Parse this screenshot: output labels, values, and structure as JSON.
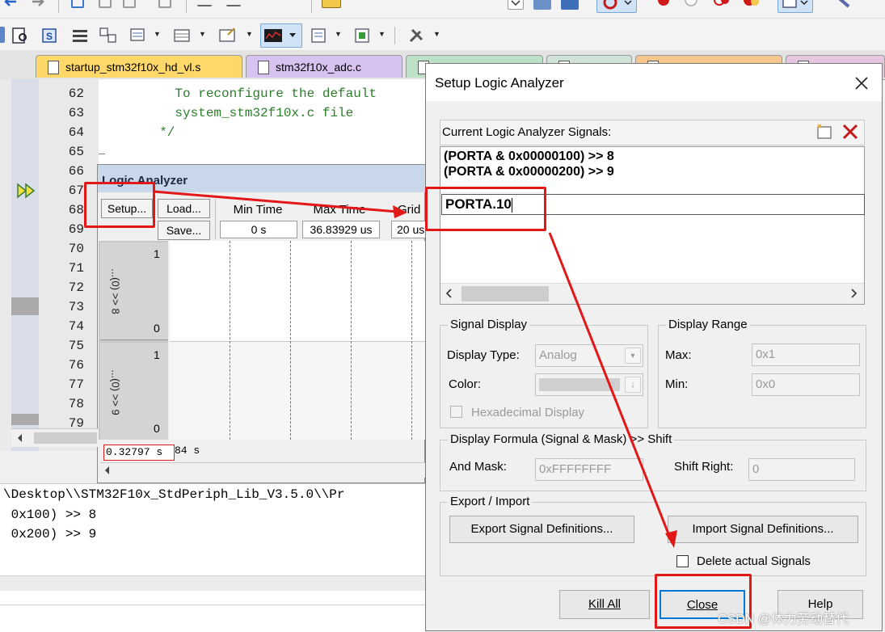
{
  "editor": {
    "tabs": [
      {
        "label": "startup_stm32f10x_hd_vl.s",
        "color": "#ffd86a"
      },
      {
        "label": "stm32f10x_adc.c",
        "color": "#d8c2f0"
      },
      {
        "label": "",
        "color": "#bde1c6"
      },
      {
        "label": "",
        "color": "#cfe3d6"
      },
      {
        "label": "",
        "color": "#f6c68f"
      },
      {
        "label": "",
        "color": "#e5c7e0"
      }
    ],
    "line_numbers": [
      "62",
      "63",
      "64",
      "65",
      "66",
      "67",
      "68",
      "69",
      "70",
      "71",
      "72",
      "73",
      "74",
      "75",
      "76",
      "77",
      "78",
      "79"
    ],
    "code_lines": [
      "    To reconfigure the default",
      "    system_stm32f10x.c file",
      "  */"
    ]
  },
  "logic_analyzer": {
    "title": "Logic Analyzer",
    "setup_label": "Setup...",
    "load_label": "Load...",
    "save_label": "Save...",
    "min_time_label": "Min Time",
    "min_time_value": "0 s",
    "max_time_label": "Max Time",
    "max_time_value": "36.83929 us",
    "grid_label": "Grid",
    "grid_value": "20 us",
    "signals": [
      {
        "name": "...(0) >> 8",
        "high": "1",
        "low": "0"
      },
      {
        "name": "...(0) >> 9",
        "high": "1",
        "low": ""
      }
    ],
    "signal2_low": "0",
    "status_time": "0.32797 s",
    "status_tail": "84 s"
  },
  "command_output": [
    "\\Desktop\\\\STM32F10x_StdPeriph_Lib_V3.5.0\\\\Pr",
    " 0x100) >> 8",
    " 0x200) >> 9"
  ],
  "dialog": {
    "title": "Setup Logic Analyzer",
    "signals_label": "Current Logic Analyzer Signals:",
    "signals": [
      "(PORTA & 0x00000100) >> 8",
      "(PORTA & 0x00000200) >> 9"
    ],
    "new_signal_value": "PORTA.10",
    "signal_display": {
      "group_label": "Signal Display",
      "display_type_label": "Display Type:",
      "display_type_value": "Analog",
      "color_label": "Color:",
      "hex_label": "Hexadecimal Display"
    },
    "display_range": {
      "group_label": "Display Range",
      "max_label": "Max:",
      "max_value": "0x1",
      "min_label": "Min:",
      "min_value": "0x0"
    },
    "formula": {
      "group_label": "Display Formula (Signal & Mask) >> Shift",
      "and_mask_label": "And Mask:",
      "and_mask_value": "0xFFFFFFFF",
      "shift_label": "Shift Right:",
      "shift_value": "0"
    },
    "export_import": {
      "group_label": "Export / Import",
      "export_button": "Export Signal Definitions...",
      "import_button": "Import Signal Definitions...",
      "delete_label": "Delete actual Signals"
    },
    "buttons": {
      "kill_all": "Kill All",
      "close": "Close",
      "help": "Help"
    }
  },
  "watermark": "CSDN @体力劳动替代",
  "colors": {
    "annotation_red": "#e21818",
    "code_green": "#2d7d2d"
  }
}
